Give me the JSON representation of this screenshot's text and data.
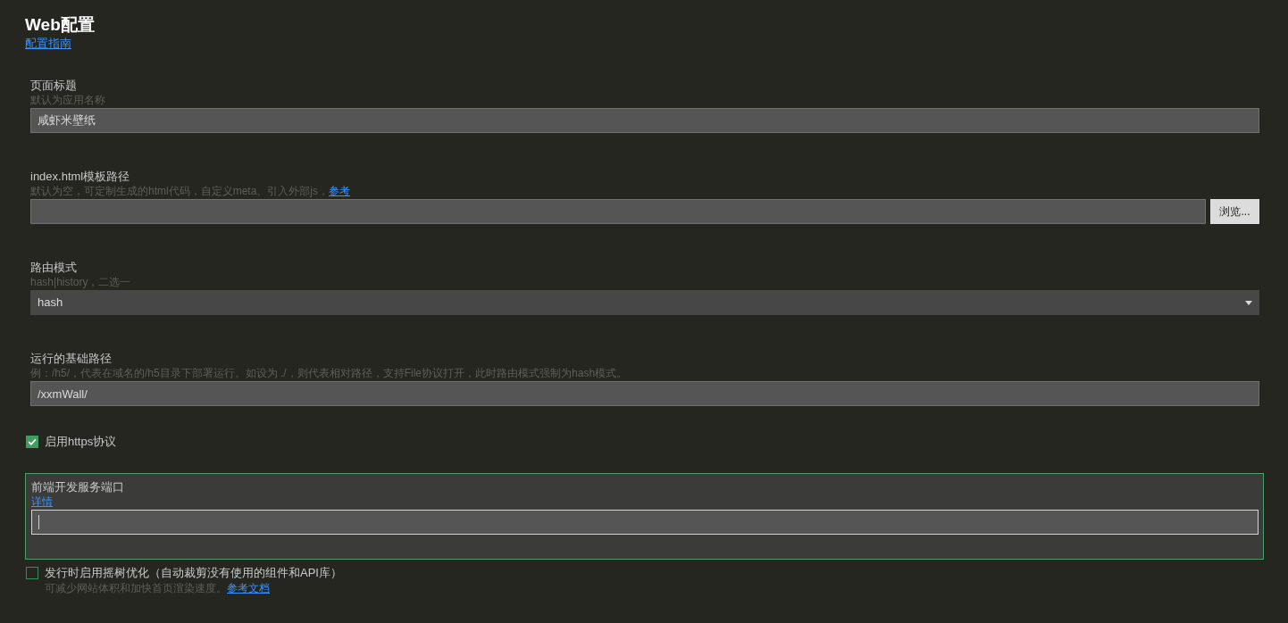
{
  "header": {
    "title": "Web配置",
    "guide_link": "配置指南"
  },
  "fields": [
    {
      "kind": "text",
      "label": "页面标题",
      "hint": "默认为应用名称",
      "value": "咸虾米壁纸",
      "focused": false
    },
    {
      "kind": "file",
      "label": "index.html模板路径",
      "hint": "默认为空，可定制生成的html代码，自定义meta、引入外部js，",
      "hint_link": "参考",
      "button": "浏览...",
      "focused": false
    },
    {
      "kind": "select",
      "label": "路由模式",
      "hint": "hash|history，二选一",
      "value": "hash",
      "focused": false
    },
    {
      "kind": "text",
      "label": "运行的基础路径",
      "hint": "例：/h5/，代表在域名的/h5目录下部署运行。如设为 ./，则代表相对路径，支持File协议打开，此时路由模式强制为hash模式。",
      "value": "/xxmWall/",
      "focused": false
    },
    {
      "kind": "checkbox",
      "label": "启用https协议",
      "checked": true
    },
    {
      "kind": "text",
      "label": "前端开发服务端口",
      "hint_link": "详情",
      "focused": true
    },
    {
      "kind": "checkbox",
      "label": "发行时启用摇树优化（自动裁剪没有使用的组件和API库）",
      "hint": "可减少网站体积和加快首页渲染速度。",
      "hint_link": "参考文档",
      "checked": false
    }
  ]
}
